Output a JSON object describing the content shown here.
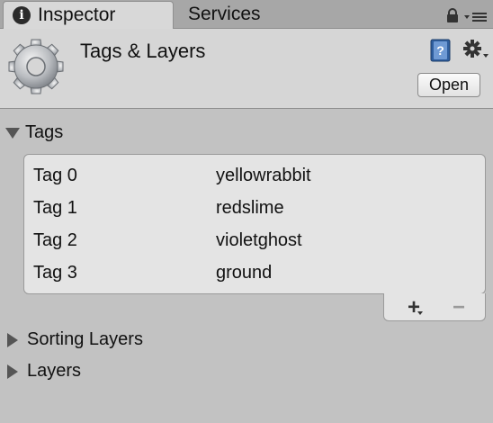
{
  "tabs": {
    "inspector_label": "Inspector",
    "services_label": "Services",
    "info_glyph": "i"
  },
  "header": {
    "title": "Tags & Layers",
    "open_label": "Open",
    "icons": [
      "gear-icon",
      "help-book-icon",
      "settings-gear-icon",
      "lock-icon",
      "panel-menu-icon"
    ]
  },
  "sections": {
    "tags_label": "Tags",
    "sorting_layers_label": "Sorting Layers",
    "layers_label": "Layers"
  },
  "tags": [
    {
      "name": "Tag 0",
      "value": "yellowrabbit"
    },
    {
      "name": "Tag 1",
      "value": "redslime"
    },
    {
      "name": "Tag 2",
      "value": "violetghost"
    },
    {
      "name": "Tag 3",
      "value": "ground"
    }
  ],
  "list_footer": {
    "add_label": "+",
    "remove_label": "−"
  },
  "colors": {
    "panel_bg": "#c2c2c2",
    "header_bg": "#d6d6d6",
    "list_bg": "#e4e4e4",
    "help_icon_blue": "#3f6fb0"
  }
}
